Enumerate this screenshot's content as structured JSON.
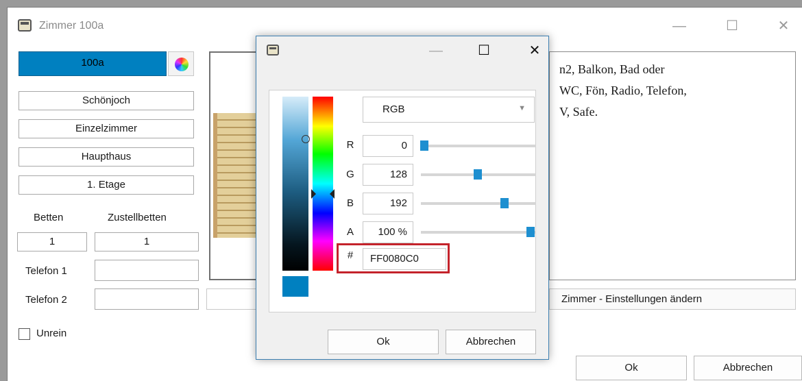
{
  "main_window": {
    "title": "Zimmer 100a",
    "room_number": "100a",
    "room_color": "#0080C0",
    "fields": {
      "building_section": "Schönjoch",
      "room_type": "Einzelzimmer",
      "house": "Haupthaus",
      "floor": "1. Etage"
    },
    "labels": {
      "beds": "Betten",
      "extra_beds": "Zustellbetten",
      "phone1": "Telefon 1",
      "phone2": "Telefon 2",
      "unclean": "Unrein"
    },
    "values": {
      "beds": "1",
      "extra_beds": "1",
      "phone1": "",
      "phone2": ""
    },
    "unclean_checked": false,
    "description_lines": [
      "n2, Balkon, Bad oder",
      "WC, Fön, Radio, Telefon,",
      "V, Safe."
    ],
    "settings_button": "Zimmer - Einstellungen ändern",
    "ok_button": "Ok",
    "cancel_button": "Abbrechen"
  },
  "color_dialog": {
    "mode": "RGB",
    "channels": [
      {
        "label": "R",
        "value": "0",
        "level": 0.0
      },
      {
        "label": "G",
        "value": "128",
        "level": 0.502
      },
      {
        "label": "B",
        "value": "192",
        "level": 0.753
      },
      {
        "label": "A",
        "value": "100 %",
        "level": 1.0
      }
    ],
    "hex_label": "#",
    "hex_value": "FF0080C0",
    "preview_color": "#0080C0",
    "ok_button": "Ok",
    "cancel_button": "Abbrechen"
  }
}
